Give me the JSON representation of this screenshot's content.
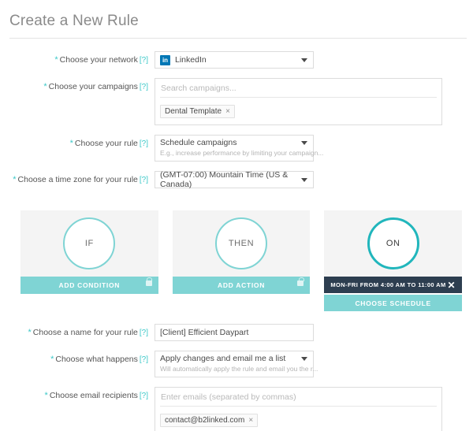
{
  "header": {
    "title": "Create a New Rule"
  },
  "required_marker": "*",
  "help_marker": "[?]",
  "form": {
    "network": {
      "label": "Choose your network",
      "icon": "linkedin-icon",
      "icon_text": "in",
      "value": "LinkedIn"
    },
    "campaigns": {
      "label": "Choose your campaigns",
      "placeholder": "Search campaigns...",
      "tokens": [
        {
          "label": "Dental Template",
          "remove": "×"
        }
      ]
    },
    "rule": {
      "label": "Choose your rule",
      "value": "Schedule campaigns",
      "hint": "E.g., increase performance by limiting your campaign..."
    },
    "timezone": {
      "label": "Choose a time zone for your rule",
      "value": "(GMT-07:00) Mountain Time (US & Canada)"
    },
    "rule_name": {
      "label": "Choose a name for your rule",
      "value": "[Client] Efficient Daypart"
    },
    "what_happens": {
      "label": "Choose what happens",
      "value": "Apply changes and email me a list",
      "hint": "Will automatically apply the rule and email you the r..."
    },
    "email_recipients": {
      "label": "Choose email recipients",
      "placeholder": "Enter emails (separated by commas)",
      "tokens": [
        {
          "label": "contact@b2linked.com",
          "remove": "×"
        }
      ]
    }
  },
  "builder": {
    "if_panel": {
      "circle_label": "IF",
      "action_label": "ADD CONDITION",
      "locked": true
    },
    "then_panel": {
      "circle_label": "THEN",
      "action_label": "ADD ACTION",
      "locked": true
    },
    "on_panel": {
      "circle_label": "ON",
      "schedule_text": "MON-FRI FROM 4:00 AM TO 11:00 AM",
      "schedule_remove": "✕",
      "action_label": "CHOOSE SCHEDULE"
    }
  },
  "colors": {
    "accent_teal": "#7fd4d4",
    "accent_teal_strong": "#21b6bc",
    "navy": "#2d3e50",
    "linkedin_blue": "#0077b5",
    "panel_bg": "#f4f4f4"
  }
}
